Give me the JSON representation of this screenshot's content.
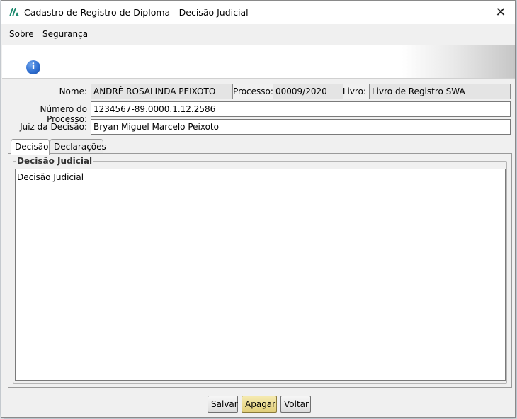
{
  "window": {
    "title": "Cadastro de Registro de Diploma - Decisão Judicial",
    "close_glyph": "✕",
    "logo_icon": "app-logo-icon"
  },
  "menu": [
    {
      "label_first": "S",
      "label_rest": "obre"
    },
    {
      "label_first": "",
      "label_rest": "Segurança"
    }
  ],
  "banner": {
    "icon": "info-icon",
    "glyph": "i"
  },
  "form": {
    "nome_label": "Nome:",
    "nome_value": "ANDRÉ ROSALINDA PEIXOTO",
    "processo_label": "Processo:",
    "processo_value": "00009/2020",
    "livro_label": "Livro:",
    "livro_value": "Livro de Registro SWA",
    "numero_label": "Número do Processo:",
    "numero_value": "1234567-89.0000.1.12.2586",
    "juiz_label": "Juiz da Decisão:",
    "juiz_value": "Bryan Miguel Marcelo Peixoto"
  },
  "tabs": [
    {
      "label": "Decisão",
      "active": true
    },
    {
      "label": "Declarações",
      "active": false
    }
  ],
  "panel": {
    "group_title": "Decisão Judicial",
    "text": "Decisão Judicial"
  },
  "buttons": {
    "salvar_first": "S",
    "salvar_rest": "alvar",
    "apagar_first": "A",
    "apagar_rest": "pagar",
    "voltar_first": "V",
    "voltar_rest": "oltar"
  },
  "colors": {
    "accent_button": "#e2cf7a",
    "info_icon": "#2f6fd1",
    "logo": "#1f8a6f"
  }
}
